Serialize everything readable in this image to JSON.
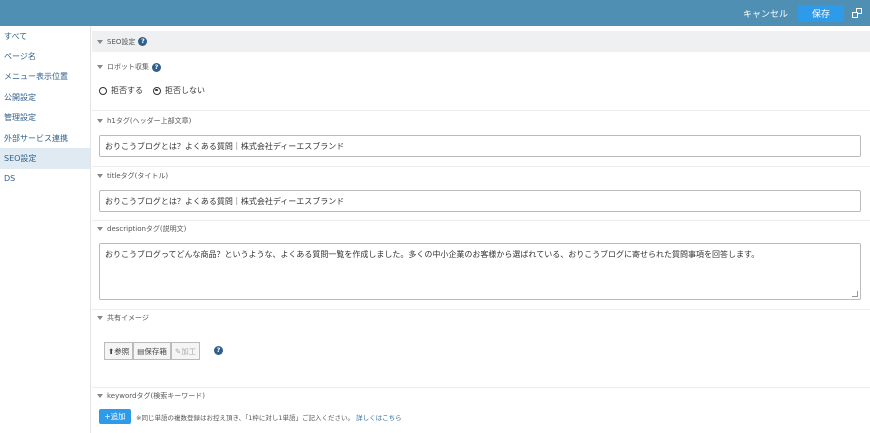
{
  "header": {
    "cancel_label": "キャンセル",
    "save_label": "保存"
  },
  "sidebar": {
    "items": [
      {
        "label": "すべて"
      },
      {
        "label": "ページ名"
      },
      {
        "label": "メニュー表示位置"
      },
      {
        "label": "公開設定"
      },
      {
        "label": "管理設定"
      },
      {
        "label": "外部サービス連携"
      },
      {
        "label": "SEO設定"
      },
      {
        "label": "DS"
      }
    ]
  },
  "seo": {
    "section_title": "SEO設定",
    "robots": {
      "label": "ロボット収集",
      "options": [
        "拒否する",
        "拒否しない"
      ],
      "selected": "拒否しない"
    },
    "h1": {
      "label": "h1タグ(ヘッダー上部文章)",
      "value": "おりこうブログとは？よくある質問｜株式会社ディーエスブランド"
    },
    "title": {
      "label": "titleタグ(タイトル)",
      "value": "おりこうブログとは？よくある質問｜株式会社ディーエスブランド"
    },
    "description": {
      "label": "descriptionタグ(説明文)",
      "value": "おりこうブログってどんな商品？というような、よくある質問一覧を作成しました。多くの中小企業のお客様から選ばれている、おりこうブログに寄せられた質問事項を回答します。"
    },
    "image": {
      "label": "共有イメージ",
      "browse": "参照",
      "storage": "保存箱",
      "edit": "加工"
    },
    "keyword": {
      "label": "keywordタグ(検索キーワード)",
      "add": "追加",
      "note": "※同じ単語の複数登録はお控え頂き、「1枠に対し1単語」ご記入ください。",
      "link": "詳しくはこちら"
    }
  }
}
